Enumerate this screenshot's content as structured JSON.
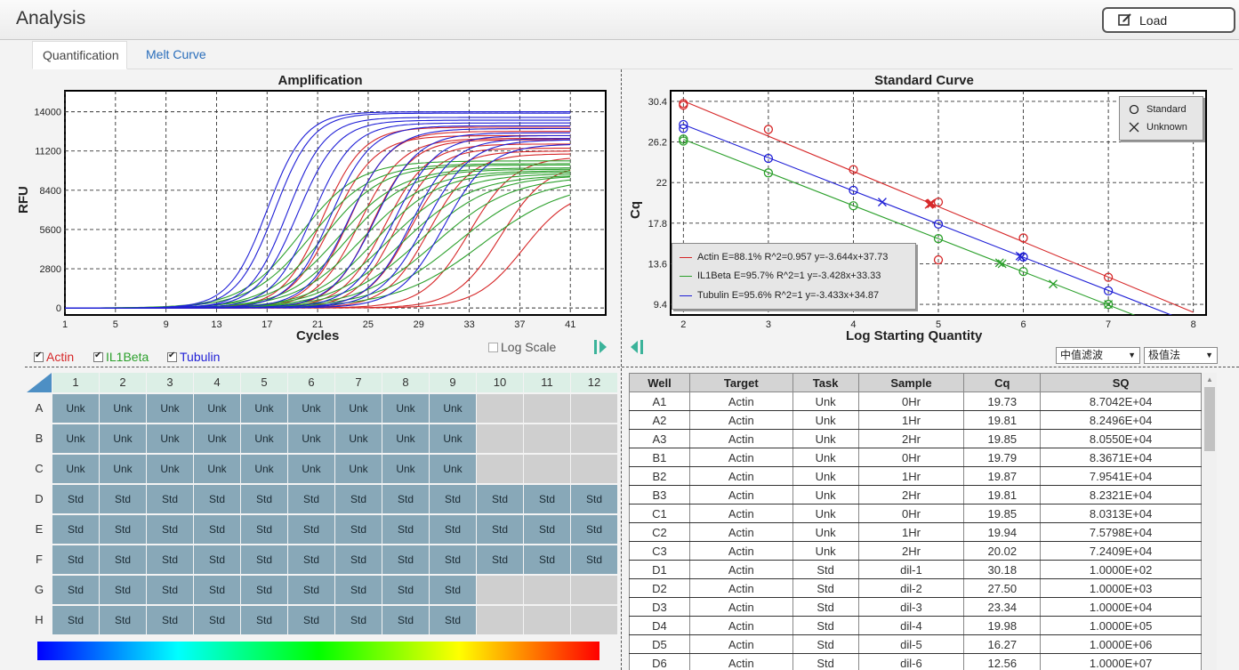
{
  "app": {
    "title": "Analysis",
    "load_label": "Load"
  },
  "tabs": [
    {
      "label": "Quantification"
    },
    {
      "label": "Melt Curve"
    }
  ],
  "amplification": {
    "title": "Amplification",
    "xlabel": "Cycles",
    "ylabel": "RFU",
    "x_ticks": [
      "1",
      "5",
      "9",
      "13",
      "17",
      "21",
      "25",
      "29",
      "33",
      "37",
      "41"
    ],
    "y_ticks": [
      "0",
      "2800",
      "5600",
      "8400",
      "11200",
      "14000"
    ],
    "log_scale_label": "Log Scale",
    "filters": [
      {
        "label": "Actin",
        "color": "#d62728"
      },
      {
        "label": "IL1Beta",
        "color": "#2ca02c"
      },
      {
        "label": "Tubulin",
        "color": "#1f1fd6"
      }
    ]
  },
  "chart_data": [
    {
      "type": "line",
      "title": "Amplification",
      "xlabel": "Cycles",
      "ylabel": "RFU",
      "xlim": [
        1,
        41
      ],
      "ylim": [
        -500,
        15500
      ],
      "model": "sigmoid RFU = plateau / (1 + exp(-(cycle - midpoint) / slope))",
      "series_groups": [
        {
          "name": "Actin",
          "color": "#d62728",
          "curves": [
            {
              "midpoint": 21.4,
              "plateau": 12900,
              "slope": 1.6
            },
            {
              "midpoint": 22.2,
              "plateau": 12300,
              "slope": 1.7
            },
            {
              "midpoint": 23.5,
              "plateau": 12600,
              "slope": 1.6
            },
            {
              "midpoint": 24.3,
              "plateau": 12100,
              "slope": 1.7
            },
            {
              "midpoint": 25.3,
              "plateau": 12000,
              "slope": 1.6
            },
            {
              "midpoint": 26.3,
              "plateau": 11700,
              "slope": 1.7
            },
            {
              "midpoint": 27.2,
              "plateau": 11400,
              "slope": 1.6
            },
            {
              "midpoint": 28.3,
              "plateau": 11200,
              "slope": 1.7
            },
            {
              "midpoint": 29.8,
              "plateau": 11000,
              "slope": 1.7
            },
            {
              "midpoint": 33.0,
              "plateau": 10800,
              "slope": 1.8
            },
            {
              "midpoint": 35.5,
              "plateau": 10300,
              "slope": 1.8
            },
            {
              "midpoint": 37.3,
              "plateau": 8500,
              "slope": 1.9
            }
          ]
        },
        {
          "name": "IL1Beta",
          "color": "#2ca02c",
          "curves": [
            {
              "midpoint": 19.6,
              "plateau": 10500,
              "slope": 2.3
            },
            {
              "midpoint": 20.5,
              "plateau": 10300,
              "slope": 2.4
            },
            {
              "midpoint": 21.5,
              "plateau": 10200,
              "slope": 2.3
            },
            {
              "midpoint": 22.6,
              "plateau": 10000,
              "slope": 2.5
            },
            {
              "midpoint": 23.4,
              "plateau": 9900,
              "slope": 2.4
            },
            {
              "midpoint": 24.5,
              "plateau": 9800,
              "slope": 2.6
            },
            {
              "midpoint": 25.6,
              "plateau": 9700,
              "slope": 2.5
            },
            {
              "midpoint": 26.6,
              "plateau": 9600,
              "slope": 2.7
            },
            {
              "midpoint": 27.8,
              "plateau": 9500,
              "slope": 2.8
            },
            {
              "midpoint": 29.0,
              "plateau": 9500,
              "slope": 2.9
            },
            {
              "midpoint": 30.4,
              "plateau": 9400,
              "slope": 3.0
            },
            {
              "midpoint": 32.0,
              "plateau": 9300,
              "slope": 3.2
            },
            {
              "midpoint": 34.0,
              "plateau": 9100,
              "slope": 3.4
            }
          ]
        },
        {
          "name": "Tubulin",
          "color": "#1f1fd6",
          "curves": [
            {
              "midpoint": 17.0,
              "plateau": 14000,
              "slope": 1.5
            },
            {
              "midpoint": 17.6,
              "plateau": 13900,
              "slope": 1.5
            },
            {
              "midpoint": 18.6,
              "plateau": 13600,
              "slope": 1.5
            },
            {
              "midpoint": 19.4,
              "plateau": 13400,
              "slope": 1.6
            },
            {
              "midpoint": 20.6,
              "plateau": 13200,
              "slope": 1.6
            },
            {
              "midpoint": 22.0,
              "plateau": 13000,
              "slope": 1.6
            },
            {
              "midpoint": 23.5,
              "plateau": 12800,
              "slope": 1.7
            },
            {
              "midpoint": 25.5,
              "plateau": 12500,
              "slope": 1.7
            },
            {
              "midpoint": 27.0,
              "plateau": 12300,
              "slope": 1.7
            },
            {
              "midpoint": 28.4,
              "plateau": 12100,
              "slope": 1.7
            },
            {
              "midpoint": 29.5,
              "plateau": 12000,
              "slope": 1.8
            },
            {
              "midpoint": 31.0,
              "plateau": 11700,
              "slope": 1.8
            }
          ]
        }
      ]
    },
    {
      "type": "scatter",
      "title": "Standard Curve",
      "xlabel": "Log Starting Quantity",
      "ylabel": "Cq",
      "xlim": [
        1.85,
        8.15
      ],
      "ylim": [
        8.3,
        31.5
      ],
      "x_ticks": [
        "2",
        "3",
        "4",
        "5",
        "6",
        "7",
        "8"
      ],
      "y_ticks": [
        "9.4",
        "13.6",
        "17.8",
        "22",
        "26.2",
        "30.4"
      ],
      "legend_markers": [
        "Standard",
        "Unknown"
      ],
      "series": [
        {
          "name": "Actin",
          "color": "#d62728",
          "fit_label": "Actin E=88.1% R^2=0.957 y=-3.644x+37.73",
          "fit": {
            "slope": -3.644,
            "intercept": 37.73,
            "x_end": 8.0
          },
          "standards": [
            [
              2,
              30.18
            ],
            [
              2,
              30.0
            ],
            [
              3,
              27.5
            ],
            [
              4,
              23.34
            ],
            [
              5,
              19.98
            ],
            [
              5,
              14.0
            ],
            [
              6,
              16.27
            ],
            [
              7,
              12.2
            ]
          ],
          "unknowns": [
            [
              4.89,
              19.73
            ],
            [
              4.92,
              19.81
            ],
            [
              4.91,
              19.85
            ],
            [
              4.9,
              19.79
            ],
            [
              4.92,
              19.87
            ]
          ]
        },
        {
          "name": "IL1Beta",
          "color": "#2ca02c",
          "fit_label": "IL1Beta E=95.7% R^2=1 y=-3.428x+33.33",
          "fit": {
            "slope": -3.428,
            "intercept": 33.33,
            "x_end": 7.4
          },
          "standards": [
            [
              2,
              26.5
            ],
            [
              2,
              26.3
            ],
            [
              3,
              23.0
            ],
            [
              4,
              19.6
            ],
            [
              5,
              16.2
            ],
            [
              6,
              12.8
            ],
            [
              7,
              9.4
            ]
          ],
          "unknowns": [
            [
              5.72,
              13.7
            ],
            [
              5.75,
              13.6
            ],
            [
              6.35,
              11.5
            ],
            [
              7.0,
              9.4
            ]
          ]
        },
        {
          "name": "Tubulin",
          "color": "#1f1fd6",
          "fit_label": "Tubulin E=95.6% R^2=1 y=-3.433x+34.87",
          "fit": {
            "slope": -3.433,
            "intercept": 34.87,
            "x_end": 7.9
          },
          "standards": [
            [
              2,
              28.0
            ],
            [
              2,
              27.6
            ],
            [
              3,
              24.5
            ],
            [
              4,
              21.2
            ],
            [
              5,
              17.7
            ],
            [
              6,
              14.3
            ],
            [
              7,
              10.8
            ]
          ],
          "unknowns": [
            [
              4.34,
              19.98
            ],
            [
              5.96,
              14.4
            ],
            [
              5.98,
              14.3
            ]
          ]
        }
      ]
    }
  ],
  "standard_curve": {
    "title": "Standard Curve",
    "xlabel": "Log Starting Quantity",
    "ylabel": "Cq",
    "legend": {
      "standard_label": "Standard",
      "unknown_label": "Unknown"
    }
  },
  "controls": {
    "filter_select": "中值滤波",
    "method_select": "极值法"
  },
  "plate": {
    "columns": [
      "1",
      "2",
      "3",
      "4",
      "5",
      "6",
      "7",
      "8",
      "9",
      "10",
      "11",
      "12"
    ],
    "rows": [
      {
        "label": "A",
        "wells": [
          "Unk",
          "Unk",
          "Unk",
          "Unk",
          "Unk",
          "Unk",
          "Unk",
          "Unk",
          "Unk",
          "",
          "",
          ""
        ]
      },
      {
        "label": "B",
        "wells": [
          "Unk",
          "Unk",
          "Unk",
          "Unk",
          "Unk",
          "Unk",
          "Unk",
          "Unk",
          "Unk",
          "",
          "",
          ""
        ]
      },
      {
        "label": "C",
        "wells": [
          "Unk",
          "Unk",
          "Unk",
          "Unk",
          "Unk",
          "Unk",
          "Unk",
          "Unk",
          "Unk",
          "",
          "",
          ""
        ]
      },
      {
        "label": "D",
        "wells": [
          "Std",
          "Std",
          "Std",
          "Std",
          "Std",
          "Std",
          "Std",
          "Std",
          "Std",
          "Std",
          "Std",
          "Std"
        ]
      },
      {
        "label": "E",
        "wells": [
          "Std",
          "Std",
          "Std",
          "Std",
          "Std",
          "Std",
          "Std",
          "Std",
          "Std",
          "Std",
          "Std",
          "Std"
        ]
      },
      {
        "label": "F",
        "wells": [
          "Std",
          "Std",
          "Std",
          "Std",
          "Std",
          "Std",
          "Std",
          "Std",
          "Std",
          "Std",
          "Std",
          "Std"
        ]
      },
      {
        "label": "G",
        "wells": [
          "Std",
          "Std",
          "Std",
          "Std",
          "Std",
          "Std",
          "Std",
          "Std",
          "Std",
          "",
          "",
          ""
        ]
      },
      {
        "label": "H",
        "wells": [
          "Std",
          "Std",
          "Std",
          "Std",
          "Std",
          "Std",
          "Std",
          "Std",
          "Std",
          "",
          "",
          ""
        ]
      }
    ]
  },
  "results": {
    "headers": [
      "Well",
      "Target",
      "Task",
      "Sample",
      "Cq",
      "SQ"
    ],
    "rows": [
      [
        "A1",
        "Actin",
        "Unk",
        "0Hr",
        "19.73",
        "8.7042E+04"
      ],
      [
        "A2",
        "Actin",
        "Unk",
        "1Hr",
        "19.81",
        "8.2496E+04"
      ],
      [
        "A3",
        "Actin",
        "Unk",
        "2Hr",
        "19.85",
        "8.0550E+04"
      ],
      [
        "B1",
        "Actin",
        "Unk",
        "0Hr",
        "19.79",
        "8.3671E+04"
      ],
      [
        "B2",
        "Actin",
        "Unk",
        "1Hr",
        "19.87",
        "7.9541E+04"
      ],
      [
        "B3",
        "Actin",
        "Unk",
        "2Hr",
        "19.81",
        "8.2321E+04"
      ],
      [
        "C1",
        "Actin",
        "Unk",
        "0Hr",
        "19.85",
        "8.0313E+04"
      ],
      [
        "C2",
        "Actin",
        "Unk",
        "1Hr",
        "19.94",
        "7.5798E+04"
      ],
      [
        "C3",
        "Actin",
        "Unk",
        "2Hr",
        "20.02",
        "7.2409E+04"
      ],
      [
        "D1",
        "Actin",
        "Std",
        "dil-1",
        "30.18",
        "1.0000E+02"
      ],
      [
        "D2",
        "Actin",
        "Std",
        "dil-2",
        "27.50",
        "1.0000E+03"
      ],
      [
        "D3",
        "Actin",
        "Std",
        "dil-3",
        "23.34",
        "1.0000E+04"
      ],
      [
        "D4",
        "Actin",
        "Std",
        "dil-4",
        "19.98",
        "1.0000E+05"
      ],
      [
        "D5",
        "Actin",
        "Std",
        "dil-5",
        "16.27",
        "1.0000E+06"
      ],
      [
        "D6",
        "Actin",
        "Std",
        "dil-6",
        "12.56",
        "1.0000E+07"
      ]
    ]
  }
}
